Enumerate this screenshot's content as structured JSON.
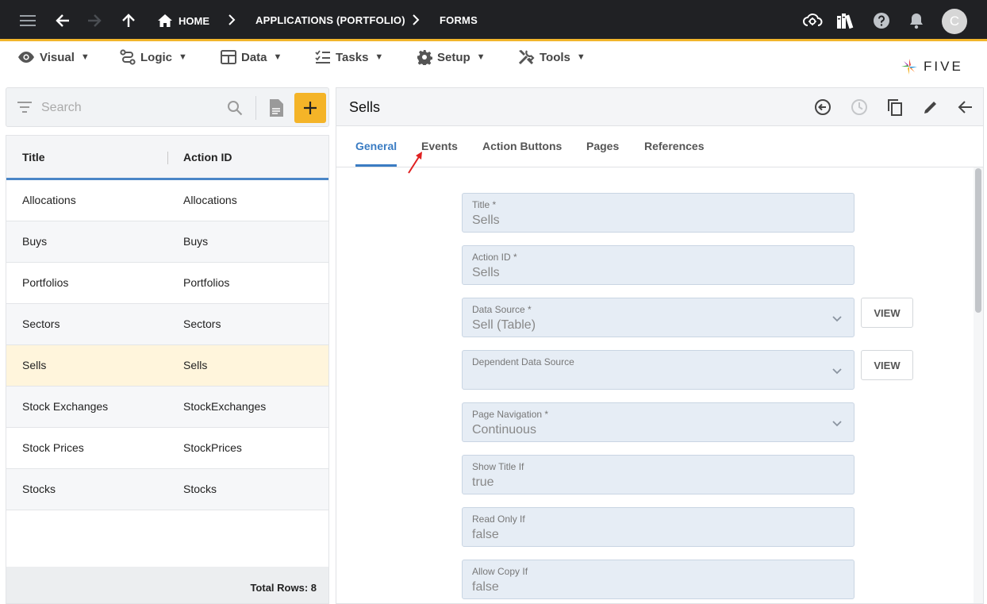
{
  "topbar": {
    "home_label": "HOME",
    "crumbs": [
      "APPLICATIONS (PORTFOLIO)",
      "FORMS"
    ],
    "avatar_initial": "C",
    "colors": {
      "background": "#202124",
      "accent": "#f2b52b"
    }
  },
  "menu": {
    "items": [
      {
        "label": "Visual",
        "icon": "eye-icon"
      },
      {
        "label": "Logic",
        "icon": "logic-icon"
      },
      {
        "label": "Data",
        "icon": "table-icon"
      },
      {
        "label": "Tasks",
        "icon": "tasks-icon"
      },
      {
        "label": "Setup",
        "icon": "gear-icon"
      },
      {
        "label": "Tools",
        "icon": "tools-icon"
      }
    ],
    "caret": "▼"
  },
  "logo": {
    "text": "FIVE"
  },
  "list": {
    "search_placeholder": "Search",
    "add_symbol": "+",
    "columns": [
      "Title",
      "Action ID"
    ],
    "rows": [
      {
        "title": "Allocations",
        "action_id": "Allocations"
      },
      {
        "title": "Buys",
        "action_id": "Buys"
      },
      {
        "title": "Portfolios",
        "action_id": "Portfolios"
      },
      {
        "title": "Sectors",
        "action_id": "Sectors"
      },
      {
        "title": "Sells",
        "action_id": "Sells",
        "selected": true
      },
      {
        "title": "Stock Exchanges",
        "action_id": "StockExchanges"
      },
      {
        "title": "Stock Prices",
        "action_id": "StockPrices"
      },
      {
        "title": "Stocks",
        "action_id": "Stocks"
      }
    ],
    "footer": "Total Rows: 8",
    "colors": {
      "selected_row": "#fff5dc",
      "add_button": "#f4b428",
      "header_rule": "#4a86c7"
    }
  },
  "detail": {
    "title": "Sells",
    "tabs": [
      "General",
      "Events",
      "Action Buttons",
      "Pages",
      "References"
    ],
    "active_tab": "General",
    "fields": [
      {
        "label": "Title *",
        "value": "Sells"
      },
      {
        "label": "Action ID *",
        "value": "Sells"
      },
      {
        "label": "Data Source *",
        "value": "Sell (Table)",
        "dropdown": true,
        "view_button": "VIEW"
      },
      {
        "label": "Dependent Data Source",
        "value": "",
        "dropdown": true,
        "view_button": "VIEW"
      },
      {
        "label": "Page Navigation *",
        "value": "Continuous",
        "dropdown": true
      },
      {
        "label": "Show Title If",
        "value": "true"
      },
      {
        "label": "Read Only If",
        "value": "false"
      },
      {
        "label": "Allow Copy If",
        "value": "false"
      }
    ],
    "colors": {
      "tab_active": "#3a7cc3",
      "field_bg": "#e6edf5",
      "annotation_arrow": "#e02020"
    }
  }
}
